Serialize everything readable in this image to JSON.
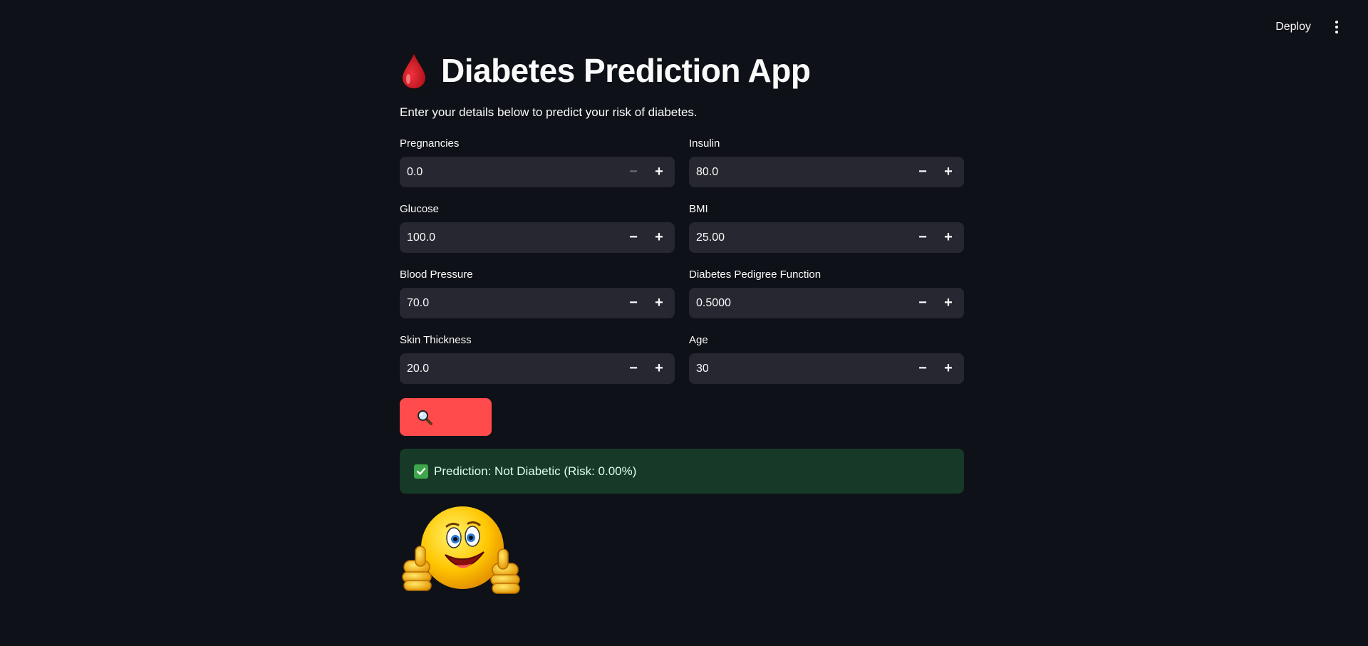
{
  "app": {
    "title": "Diabetes Prediction App",
    "subtitle": "Enter your details below to predict your risk of diabetes."
  },
  "toolbar": {
    "deploy_label": "Deploy",
    "menu_icon": "kebab-menu-icon"
  },
  "form": {
    "fields": [
      {
        "label": "Pregnancies",
        "value": "0.0",
        "minus_disabled": true
      },
      {
        "label": "Insulin",
        "value": "80.0",
        "minus_disabled": false
      },
      {
        "label": "Glucose",
        "value": "100.0",
        "minus_disabled": false
      },
      {
        "label": "BMI",
        "value": "25.00",
        "minus_disabled": false
      },
      {
        "label": "Blood Pressure",
        "value": "70.0",
        "minus_disabled": false
      },
      {
        "label": "Diabetes Pedigree Function",
        "value": "0.5000",
        "minus_disabled": false
      },
      {
        "label": "Skin Thickness",
        "value": "20.0",
        "minus_disabled": false
      },
      {
        "label": "Age",
        "value": "30",
        "minus_disabled": false
      }
    ],
    "minus_symbol": "−",
    "plus_symbol": "+"
  },
  "predict_button": {
    "icon": "magnifying-glass-icon",
    "color": "#ff4b4b"
  },
  "result": {
    "text": "Prediction: Not Diabetic (Risk: 0.00%)",
    "icon": "check-mark-icon",
    "background": "#173928"
  },
  "result_image": {
    "icon": "thumbs-up-smiley-icon"
  },
  "colors": {
    "background": "#0e1117",
    "input_bg": "#262730",
    "accent": "#ff4b4b"
  }
}
